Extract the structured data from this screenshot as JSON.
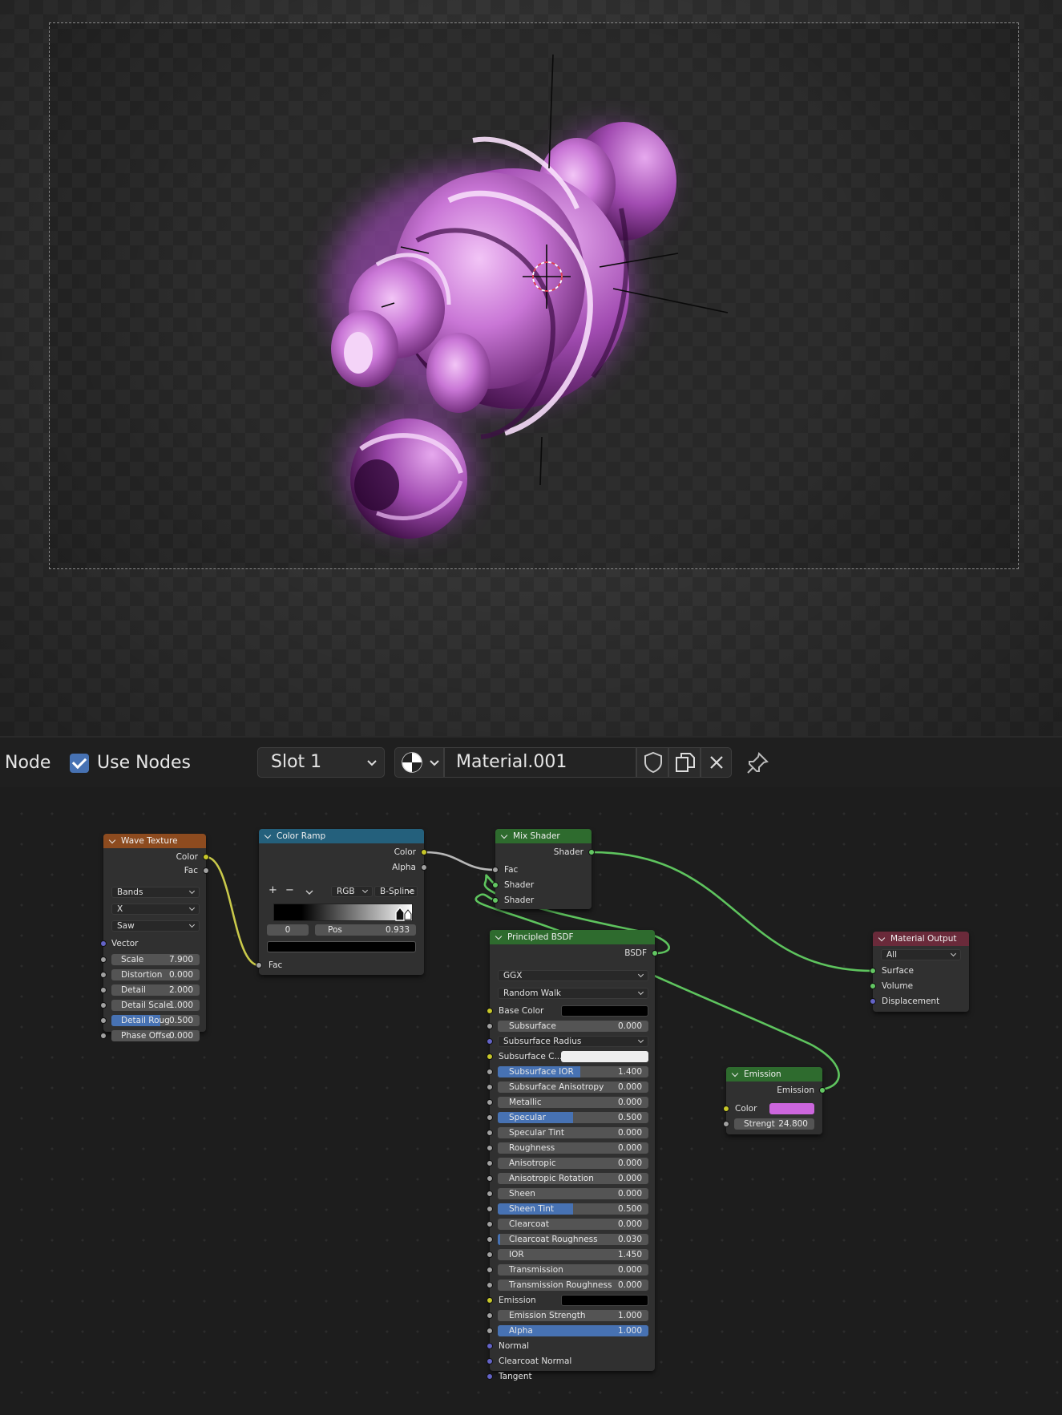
{
  "header": {
    "editor_label": "Node",
    "use_nodes_label": "Use Nodes",
    "use_nodes_checked": true,
    "slot_label": "Slot 1",
    "material_name": "Material.001"
  },
  "icons": [
    "sphere-material-icon",
    "shield-icon",
    "duplicate-icon",
    "close-icon",
    "pin-icon",
    "chevron-down-icon"
  ],
  "colors": {
    "wave_header": "#8d4b1f",
    "colorramp_header": "#24607c",
    "shader_header": "#2e6b2e",
    "output_header": "#6a2a3a",
    "emission_color": "#cc66dd",
    "accent": "#4772b3"
  },
  "wave_texture": {
    "title": "Wave Texture",
    "outputs": [
      "Color",
      "Fac"
    ],
    "wave_type": "Bands",
    "direction": "X",
    "profile": "Saw",
    "vector_label": "Vector",
    "fields": [
      {
        "label": "Scale",
        "value": "7.900"
      },
      {
        "label": "Distortion",
        "value": "0.000"
      },
      {
        "label": "Detail",
        "value": "2.000"
      },
      {
        "label": "Detail Scale",
        "value": "1.000"
      },
      {
        "label": "Detail Roug",
        "value": "0.500"
      },
      {
        "label": "Phase Offse",
        "value": "0.000"
      }
    ]
  },
  "color_ramp": {
    "title": "Color Ramp",
    "outputs": [
      "Color",
      "Alpha"
    ],
    "add": "+",
    "remove": "−",
    "mode": "RGB",
    "interpolation": "B-Spline",
    "index": "0",
    "pos_label": "Pos",
    "pos_value": "0.933",
    "input": "Fac"
  },
  "mix_shader": {
    "title": "Mix Shader",
    "output": "Shader",
    "inputs": [
      "Fac",
      "Shader",
      "Shader"
    ]
  },
  "principled": {
    "title": "Principled BSDF",
    "output": "BSDF",
    "distribution": "GGX",
    "subsurface_method": "Random Walk",
    "base_color_label": "Base Color",
    "subsurface": {
      "label": "Subsurface",
      "value": "0.000"
    },
    "subsurface_radius": "Subsurface Radius",
    "subsurface_color_label": "Subsurface C...",
    "fields": [
      {
        "label": "Subsurface IOR",
        "value": "1.400"
      },
      {
        "label": "Subsurface Anisotropy",
        "value": "0.000"
      },
      {
        "label": "Metallic",
        "value": "0.000"
      },
      {
        "label": "Specular",
        "value": "0.500"
      },
      {
        "label": "Specular Tint",
        "value": "0.000"
      },
      {
        "label": "Roughness",
        "value": "0.000"
      },
      {
        "label": "Anisotropic",
        "value": "0.000"
      },
      {
        "label": "Anisotropic Rotation",
        "value": "0.000"
      },
      {
        "label": "Sheen",
        "value": "0.000"
      },
      {
        "label": "Sheen Tint",
        "value": "0.500"
      },
      {
        "label": "Clearcoat",
        "value": "0.000"
      },
      {
        "label": "Clearcoat Roughness",
        "value": "0.030"
      },
      {
        "label": "IOR",
        "value": "1.450"
      },
      {
        "label": "Transmission",
        "value": "0.000"
      },
      {
        "label": "Transmission Roughness",
        "value": "0.000"
      }
    ],
    "emission_label": "Emission",
    "emission_strength": {
      "label": "Emission Strength",
      "value": "1.000"
    },
    "alpha": {
      "label": "Alpha",
      "value": "1.000"
    },
    "vector_inputs": [
      "Normal",
      "Clearcoat Normal",
      "Tangent"
    ]
  },
  "emission": {
    "title": "Emission",
    "output": "Emission",
    "color_label": "Color",
    "strength": {
      "label": "Strengt",
      "value": "24.800"
    }
  },
  "material_output": {
    "title": "Material Output",
    "target": "All",
    "inputs": [
      "Surface",
      "Volume",
      "Displacement"
    ]
  }
}
